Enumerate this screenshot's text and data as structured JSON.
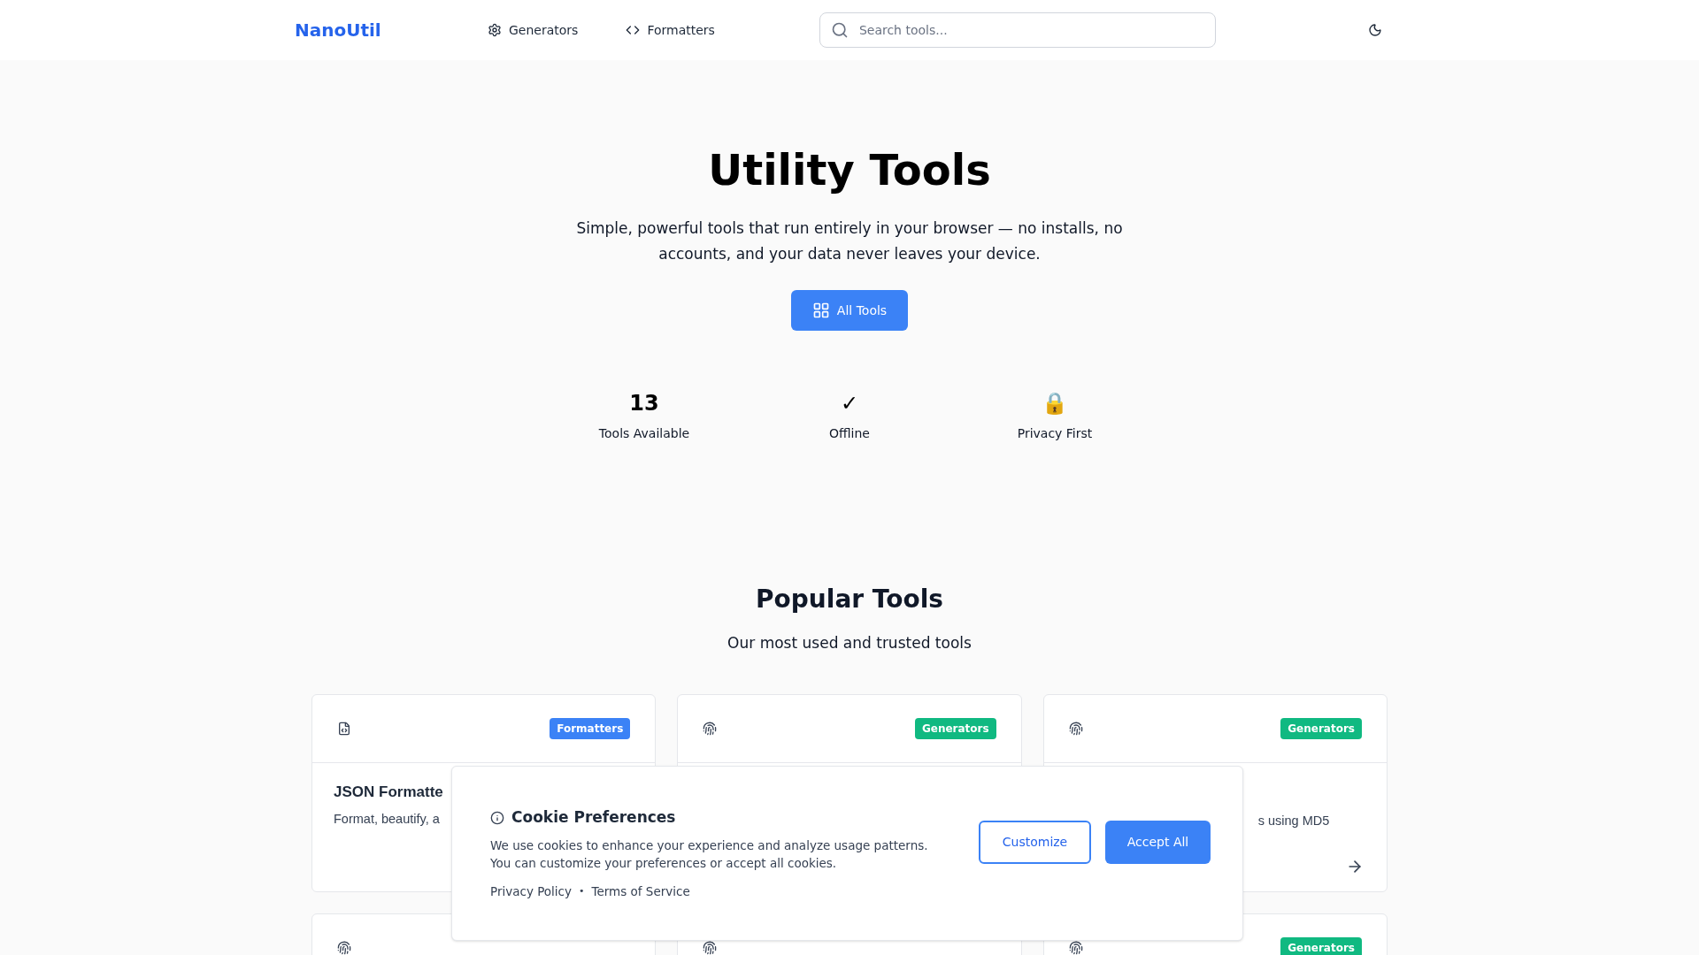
{
  "header": {
    "logo": "NanoUtil",
    "nav": [
      {
        "kind": "gear",
        "label": "Generators"
      },
      {
        "kind": "code",
        "label": "Formatters"
      }
    ],
    "search": {
      "placeholder": "Search tools..."
    }
  },
  "hero": {
    "title": "Utility Tools",
    "subtitle": "Simple, powerful tools that run entirely in your browser — no installs, no accounts, and your data never leaves your device.",
    "button": "All Tools"
  },
  "stats": [
    {
      "kind": "text",
      "value": "13",
      "label": "Tools Available"
    },
    {
      "kind": "text",
      "value": "✓",
      "label": "Offline"
    },
    {
      "kind": "emoji",
      "value": "🔒",
      "label": "Privacy First"
    }
  ],
  "popular": {
    "title": "Popular Tools",
    "subtitle": "Our most used and trusted tools",
    "cards": [
      {
        "kind": "file",
        "badge": "Formatters",
        "color": "#3b82f6",
        "title": "JSON Formatte",
        "description": "Format, beautify, a"
      },
      {
        "kind": "fingerprint",
        "badge": "Generators",
        "color": "#10b981"
      },
      {
        "kind": "fingerprint",
        "badge": "Generators",
        "color": "#10b981",
        "description": "s using MD5",
        "arrow": true
      },
      {
        "kind": "fingerprint"
      },
      {
        "kind": "fingerprint"
      },
      {
        "kind": "fingerprint",
        "badge": "Generators",
        "color": "#10b981"
      }
    ]
  },
  "cookie_banner": {
    "title": "Cookie Preferences",
    "text": "We use cookies to enhance your experience and analyze usage patterns. You can customize your preferences or accept all cookies.",
    "links": [
      "Privacy Policy",
      "Terms of Service"
    ],
    "separator": "•",
    "buttons": [
      {
        "kind": "outline",
        "label": "Customize"
      },
      {
        "kind": "primary",
        "label": "Accept All"
      }
    ]
  }
}
